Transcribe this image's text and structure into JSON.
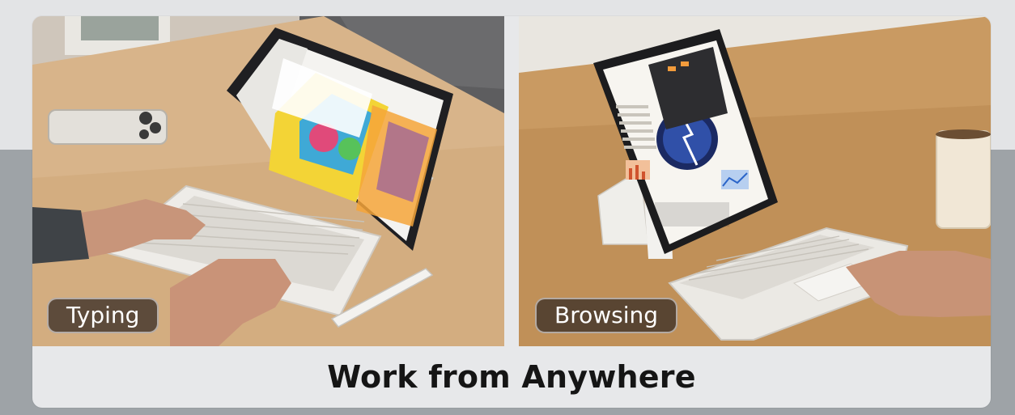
{
  "panels": {
    "left": {
      "label": "Typing"
    },
    "right": {
      "label": "Browsing"
    }
  },
  "caption": "Work from Anywhere",
  "colors": {
    "label_bg": "#3c3028",
    "caption_text": "#151515",
    "card_bg": "#e7e8ea"
  }
}
